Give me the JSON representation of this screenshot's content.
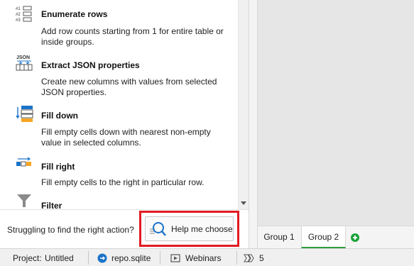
{
  "actions": [
    {
      "title": "Enumerate rows",
      "description": "Add row counts starting from 1 for entire table or inside groups.",
      "icon": "enumerate-rows-icon",
      "icon_labels": [
        "#1",
        "#2",
        "#3"
      ]
    },
    {
      "title": "Extract JSON properties",
      "description": "Create new columns with values from selected JSON properties.",
      "icon": "extract-json-icon",
      "icon_label": "JSON"
    },
    {
      "title": "Fill down",
      "description": "Fill empty cells down with nearest non-empty value in selected columns.",
      "icon": "fill-down-icon"
    },
    {
      "title": "Fill right",
      "description": "Fill empty cells to the right in particular row.",
      "icon": "fill-right-icon"
    },
    {
      "title": "Filter",
      "icon": "filter-icon"
    }
  ],
  "help": {
    "prompt": "Struggling to find the right action?",
    "button_label": "Help me choose"
  },
  "tabs": [
    {
      "label": "Group 1",
      "active": false
    },
    {
      "label": "Group 2",
      "active": true
    }
  ],
  "status": {
    "project_label": "Project:",
    "project_name": "Untitled",
    "database": "repo.sqlite",
    "webinars": "Webinars",
    "count": "5"
  },
  "colors": {
    "accent_blue": "#1a73c8",
    "fill_yellow": "#f5a623",
    "highlight_red": "#e01b22",
    "tab_green": "#2e9e3e"
  }
}
